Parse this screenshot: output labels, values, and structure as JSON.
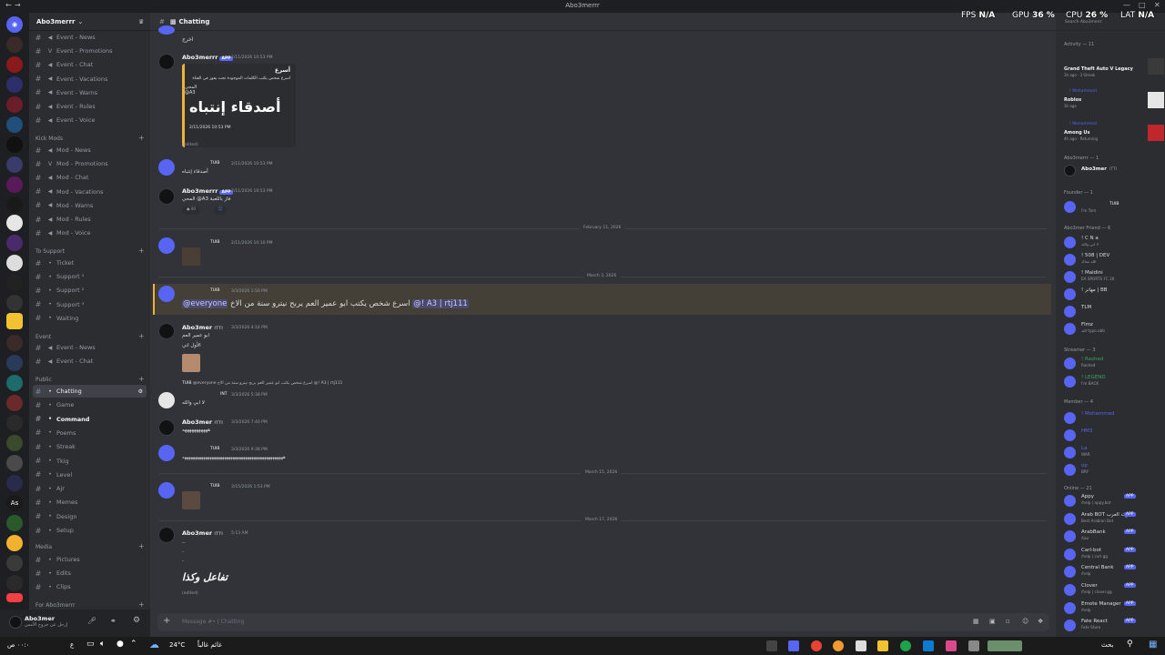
{
  "window": {
    "title": "Abo3merrr"
  },
  "overlay": {
    "fps_label": "FPS",
    "fps_value": "N/A",
    "gpu_label": "GPU",
    "gpu_value": "36 %",
    "cpu_label": "CPU",
    "cpu_value": "26 %",
    "lat_label": "LAT",
    "lat_value": "N/A",
    "search_placeholder": "Search Abo3merrr"
  },
  "guild": {
    "name": "Abo3merrr"
  },
  "sidebar": {
    "channels_top": [
      {
        "prefix": "◀",
        "label": "Event - News"
      },
      {
        "prefix": "V",
        "label": "Event - Promotions"
      },
      {
        "prefix": "◀",
        "label": "Event - Chat"
      },
      {
        "prefix": "◀",
        "label": "Event - Vacations"
      },
      {
        "prefix": "◀",
        "label": "Event - Warns"
      },
      {
        "prefix": "◀",
        "label": "Event - Rules"
      },
      {
        "prefix": "◀",
        "label": "Event - Voice"
      }
    ],
    "cat_kick": "Kick Mods",
    "channels_kick": [
      {
        "prefix": "◀",
        "label": "Mod - News"
      },
      {
        "prefix": "V",
        "label": "Mod - Promotions"
      },
      {
        "prefix": "◀",
        "label": "Mod - Chat"
      },
      {
        "prefix": "◀",
        "label": "Mod - Vacations"
      },
      {
        "prefix": "◀",
        "label": "Mod - Warns"
      },
      {
        "prefix": "◀",
        "label": "Mod - Rules"
      },
      {
        "prefix": "◀",
        "label": "Mod - Voice"
      }
    ],
    "cat_support": "To Support",
    "channels_support": [
      {
        "prefix": "•",
        "label": "Ticket"
      },
      {
        "prefix": "•",
        "label": "Support ¹"
      },
      {
        "prefix": "•",
        "label": "Support ²"
      },
      {
        "prefix": "•",
        "label": "Support ³"
      },
      {
        "prefix": "•",
        "label": "Waiting"
      }
    ],
    "cat_event": "Event",
    "channels_event": [
      {
        "prefix": "◀",
        "label": "Event - News"
      },
      {
        "prefix": "◀",
        "label": "Event - Chat"
      }
    ],
    "cat_public": "Public",
    "channels_public": [
      {
        "prefix": "•",
        "label": "Chatting",
        "active": true
      },
      {
        "prefix": "•",
        "label": "Game"
      },
      {
        "prefix": "•",
        "label": "Command",
        "bright": true
      },
      {
        "prefix": "•",
        "label": "Poems"
      },
      {
        "prefix": "•",
        "label": "Streak"
      },
      {
        "prefix": "•",
        "label": "Tkig"
      },
      {
        "prefix": "•",
        "label": "Level"
      },
      {
        "prefix": "•",
        "label": "Ajr"
      },
      {
        "prefix": "•",
        "label": "Memes"
      },
      {
        "prefix": "•",
        "label": "Design"
      },
      {
        "prefix": "•",
        "label": "Setup"
      }
    ],
    "cat_media": "Media",
    "channels_media": [
      {
        "prefix": "•",
        "label": "Pictures"
      },
      {
        "prefix": "•",
        "label": "Edits"
      },
      {
        "prefix": "•",
        "label": "Clips"
      }
    ],
    "cat_for": "For Abo3merrr"
  },
  "userpanel": {
    "name": "Abo3mer",
    "status": "إرحل عن جروح الأمس"
  },
  "chat": {
    "channel": "Chatting",
    "composer_placeholder": "Message #• | Chatting",
    "top_line": "اخرج",
    "m1_user": "Abo3merrr",
    "m1_app": "APP",
    "m1_ts": "2/11/2026 10:53 PM",
    "embed_title": "أسرع",
    "embed_line1": "اسرع شخص يكتب الكلمات الموجودة تحت يفوز في القناة",
    "embed_line2": "المحي @A3",
    "embed_big": "أصدقاء إنتباه",
    "embed_ts": "2/11/2026 10:53 PM",
    "edited": "(edited)",
    "m2_tag": "TUIB",
    "m2_ts": "2/11/2026 10:53 PM",
    "m2_text": "أصدقاء إنتباه",
    "m3_user": "Abo3merrr",
    "m3_app": "APP",
    "m3_ts": "2/11/2026 10:53 PM",
    "m3_text": "المحي @A3 فاز باللعبة",
    "div1": "February 11, 2026",
    "m4_tag": "TUIB",
    "m4_ts": "2/11/2026 10:10 PM",
    "div2": "March 3, 2026",
    "m5_tag": "TUIB",
    "m5_ts": "3/3/2026 1:50 PM",
    "m5_mention": "@everyone",
    "m5_text": "اسرع شخص يكتب ابو عمير العم يربح نيترو سنة من الاخ",
    "m5_mention2": "@! A3 | rtj111",
    "m6_user": "Abo3mer",
    "m6_tag": "ITTI",
    "m6_ts": "3/3/2026 4:14 PM",
    "m6_l1": "ابو عمير العم",
    "m6_l2": "الأول اني",
    "m7_reply": "@everyone اسرع شخص يكتب ابو عمير العم يربح نيترو سنة من الاخ @! A3 | rtj111",
    "m7_tag": "INT",
    "m7_ts": "3/3/2026 5:38 PM",
    "m7_text": "لا ابي والله",
    "m8_user": "Abo3mer",
    "m8_tag": "ITTI",
    "m8_ts": "3/3/2026 7:40 PM",
    "m8_text": "هههههههههههه",
    "m9_tag": "TUIB",
    "m9_ts": "3/3/2026 9:38 PM",
    "m9_text": "ههههههههههههههههههههههههههههههههههههههههههههههههه",
    "div3": "March 15, 2026",
    "m10_tag": "TUIB",
    "m10_ts": "3/15/2026 1:53 PM",
    "div4": "March 17, 2026",
    "m11_user": "Abo3mer",
    "m11_tag": "ITTI",
    "m11_ts": "5:13 AM",
    "m11_l1": "..",
    "m11_l2": ".",
    "m11_l3": ".",
    "m11_big": "تفاعل وكذا",
    "m11_edited": "(edited)"
  },
  "members": {
    "activity": "Activity — 11",
    "act1_name": "Grand Theft Auto V Legacy",
    "act1_sub": "3h ago · 3 Streak",
    "act2_user": "! Mohammed",
    "act2_name": "Roblox",
    "act2_sub": "3h ago",
    "act3_user": "! Mohammed",
    "act3_name": "Among Us",
    "act3_sub": "4h ago · Returning",
    "owner_cat": "Abo3merrr — 1",
    "owner_name": "Abo3mer",
    "owner_tag": "ITTI",
    "founder_cat": "Founder — 1",
    "founder_tag": "TUIB",
    "founder_sub": "I'm Tom",
    "friend_cat": "Abo3mer Friend — 6",
    "friends": [
      {
        "name": "! C N a",
        "sub": "لا ابي والله"
      },
      {
        "name": "! 508 | DEV",
        "sub": "الله معاك"
      },
      {
        "name": "! Maldini",
        "sub": "EA SPORTS FC 26"
      },
      {
        "name": "! مهاتر | BB",
        "sub": ""
      },
      {
        "name": "TLM",
        "sub": ""
      },
      {
        "name": "Flmz",
        "sub": "الله typo.abb"
      }
    ],
    "streamer_cat": "Streamer — 3",
    "streamers": [
      {
        "name": "! Rashed",
        "sub": "Rashed"
      },
      {
        "name": "! LEGEND",
        "sub": "I'm BACK"
      }
    ],
    "member_cat": "Member — 4",
    "member_list": [
      {
        "name": "! Mohammed",
        "sub": ""
      },
      {
        "name": "HM3",
        "sub": ""
      },
      {
        "name": "La",
        "sub": "WAR"
      },
      {
        "name": "op",
        "sub": "BRY"
      }
    ],
    "online_cat": "Online — 21",
    "online_list": [
      {
        "name": "Appy",
        "sub": "/help | appy.bot"
      },
      {
        "name": "Arab BOT بوت العرب",
        "sub": "Best Arabian Bot"
      },
      {
        "name": "ArabBank",
        "sub": "/tax"
      },
      {
        "name": "Carl-bot",
        "sub": "/help | carl.gg"
      },
      {
        "name": "Central Bank",
        "sub": "/help"
      },
      {
        "name": "Clover",
        "sub": "/help | clover.gg"
      },
      {
        "name": "Emote Manager",
        "sub": "/help"
      },
      {
        "name": "Fate React",
        "sub": "Fate Store"
      }
    ],
    "app_badge": "APP"
  },
  "taskbar": {
    "time": "٠٠:٠ ص",
    "lang": "ع",
    "weather": "24°C",
    "weather_text": "غائم غالباً",
    "search": "بحث"
  },
  "colors": {
    "accent": "#5865f2",
    "bg_chat": "#313338",
    "bg_side": "#2b2d31",
    "bg_rail": "#1e1f22",
    "highlight": "#f0b232"
  }
}
